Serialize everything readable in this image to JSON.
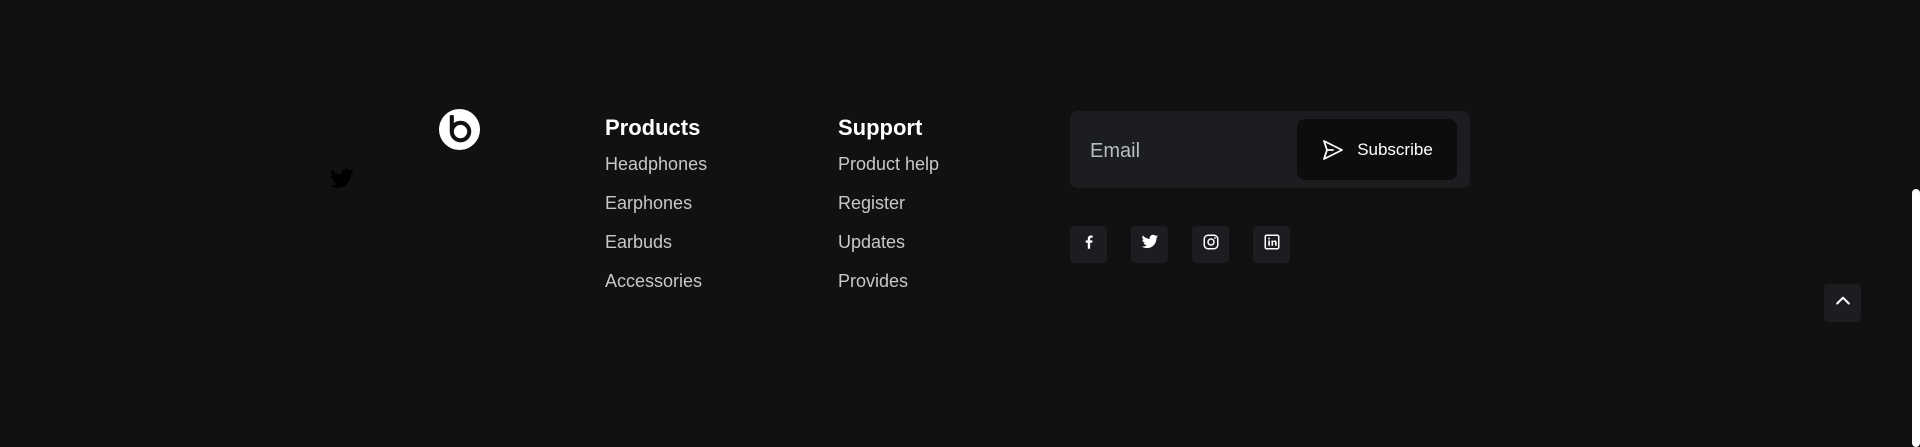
{
  "stray_icon": {
    "name": "twitter-icon"
  },
  "brand": {
    "logo_icon": "beats-logo-icon"
  },
  "products": {
    "title": "Products",
    "links": [
      "Headphones",
      "Earphones",
      "Earbuds",
      "Accessories"
    ]
  },
  "support": {
    "title": "Support",
    "links": [
      "Product help",
      "Register",
      "Updates",
      "Provides"
    ]
  },
  "subscribe": {
    "placeholder": "Email",
    "button_label": "Subscribe",
    "button_icon": "send-icon"
  },
  "socials": [
    {
      "name": "facebook-icon"
    },
    {
      "name": "twitter-icon"
    },
    {
      "name": "instagram-icon"
    },
    {
      "name": "linkedin-icon"
    }
  ],
  "back_to_top": {
    "icon": "chevron-up-icon"
  },
  "colors": {
    "background": "#111111",
    "panel": "#1c1d20",
    "button": "#0d0d0d",
    "link": "#c8c8c8",
    "heading": "#ffffff"
  }
}
